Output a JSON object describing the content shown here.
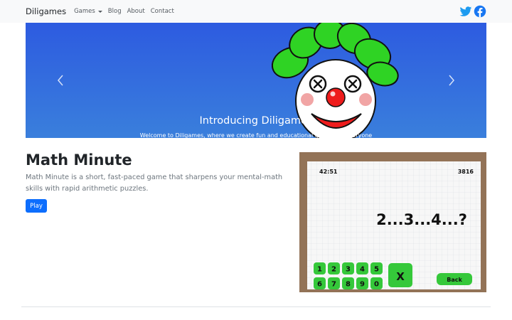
{
  "navbar": {
    "brand": "Diligames",
    "links": [
      {
        "label": "Games",
        "dropdown": true
      },
      {
        "label": "Blog"
      },
      {
        "label": "About"
      },
      {
        "label": "Contact"
      }
    ],
    "social_icons": [
      "twitter-icon",
      "facebook-icon"
    ]
  },
  "carousel": {
    "title": "Introducing Diligames",
    "text": "Welcome to Diligames, where we create fun and educational games for everyone",
    "slide_count": 3,
    "active_slide": 1
  },
  "feature": {
    "title": "Math Minute",
    "description": "Math Minute is a short, fast-paced game that sharpens your mental-math skills with rapid arithmetic puzzles.",
    "button": "Play",
    "screenshot": {
      "timer": "42:51",
      "score": "3816",
      "puzzle": "2...3...4...?",
      "keys_row1": [
        "1",
        "2",
        "3",
        "4",
        "5"
      ],
      "keys_row2": [
        "6",
        "7",
        "8",
        "9",
        "0"
      ],
      "clear_key": "X",
      "back_label": "Back"
    }
  },
  "colors": {
    "navbar_bg": "#f8f9fa",
    "carousel_top": "#2d5be0",
    "carousel_bottom": "#3a7fdc",
    "primary": "#0d6efd",
    "twitter": "#1d9bf0",
    "facebook": "#1877f2",
    "game_green": "#35c83a"
  }
}
